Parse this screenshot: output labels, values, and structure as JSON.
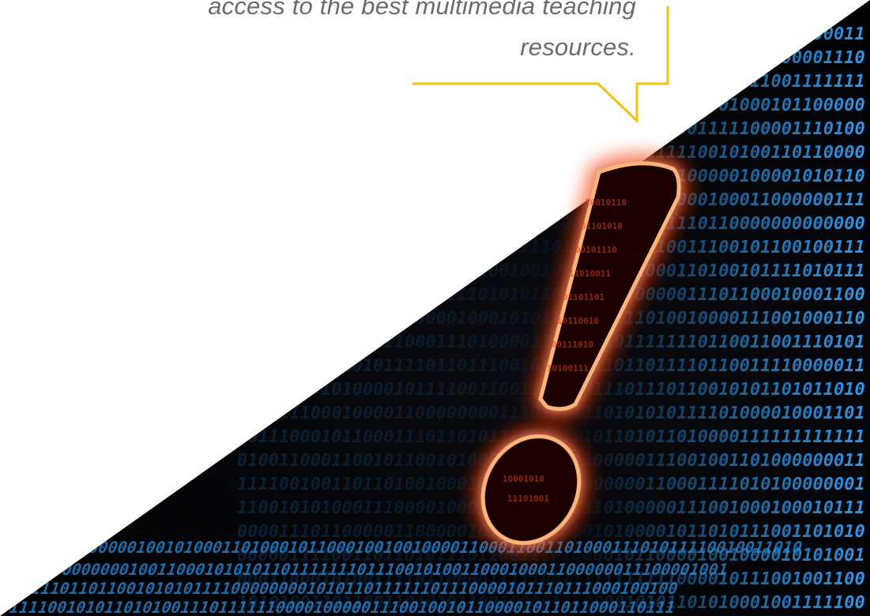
{
  "quote": {
    "line1": "access to the best multimedia teaching",
    "line2": "resources."
  },
  "colors": {
    "accent": "#f2c20f",
    "background": "#ffffff",
    "dark_panel": "#050608",
    "binary_blue": "#1f8fe0",
    "glow_orange": "#ff5a1a",
    "text": "#6b6b6b"
  },
  "icons": {
    "speech_tail": "speech-bubble-tail-icon",
    "exclamation": "exclamation-mark-icon"
  }
}
